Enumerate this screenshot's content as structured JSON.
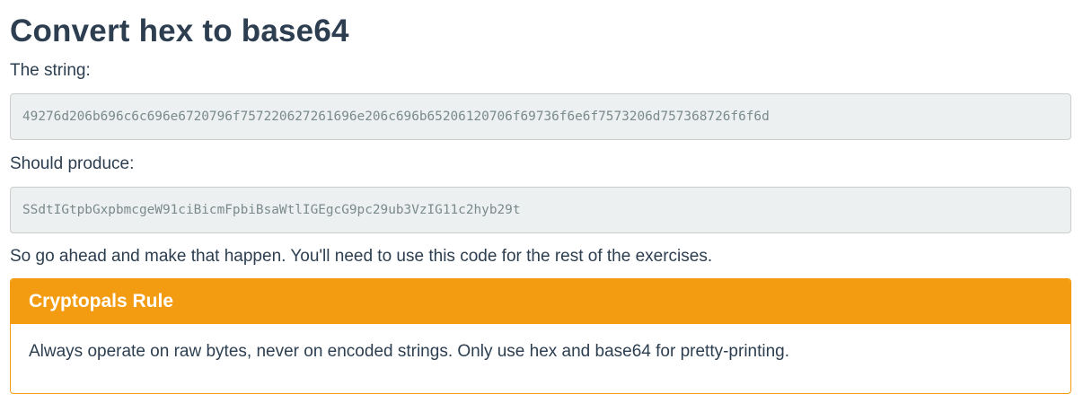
{
  "page": {
    "title": "Convert hex to base64",
    "input_label": "The string:",
    "input_value": "49276d206b696c6c696e6720796f757220627261696e206c696b65206120706f69736f6e6f7573206d757368726f6f6d",
    "output_label": "Should produce:",
    "output_value": "SSdtIGtpbGxpbmcgeW91ciBicmFpbiBsaWtlIGEgcG9pc29ub3VzIG11c2hyb29t",
    "instruction": "So go ahead and make that happen. You'll need to use this code for the rest of the exercises."
  },
  "rule_panel": {
    "heading": "Cryptopals Rule",
    "body": "Always operate on raw bytes, never on encoded strings. Only use hex and base64 for pretty-printing."
  },
  "colors": {
    "heading_text": "#2c3e50",
    "code_background": "#ecf0f1",
    "code_text": "#7b8a8b",
    "warning_accent": "#f39c12"
  }
}
